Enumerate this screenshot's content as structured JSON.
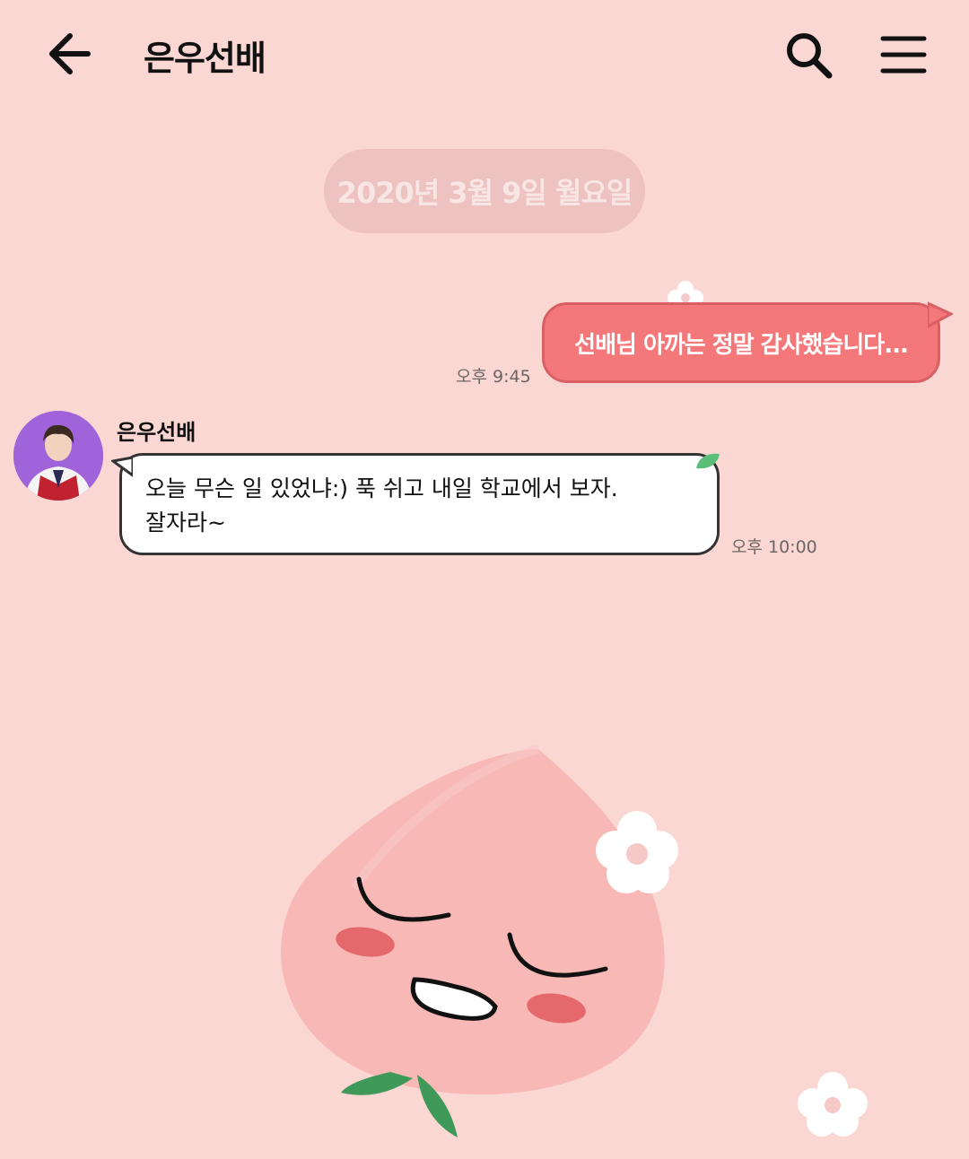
{
  "header": {
    "title": "은우선배",
    "back_icon": "arrow-left-icon",
    "search_icon": "search-icon",
    "menu_icon": "hamburger-menu-icon"
  },
  "date_divider": "2020년 3월 9일 월요일",
  "messages": [
    {
      "direction": "sent",
      "text": "선배님 아까는 정말 감사했습니다...",
      "time": "오후 9:45"
    },
    {
      "direction": "received",
      "sender": "은우선배",
      "lines": [
        "오늘 무슨 일 있었냐:) 푹 쉬고 내일 학교에서 보자.",
        "잘자라~"
      ],
      "time": "오후 10:00"
    }
  ],
  "colors": {
    "background": "#fbd7d3",
    "sent_bubble": "#f4777a",
    "received_bubble": "#ffffff",
    "date_pill": "#edc2c0"
  },
  "decorations": [
    "peach-character-illustration",
    "flower-icon",
    "leaf-icon"
  ]
}
